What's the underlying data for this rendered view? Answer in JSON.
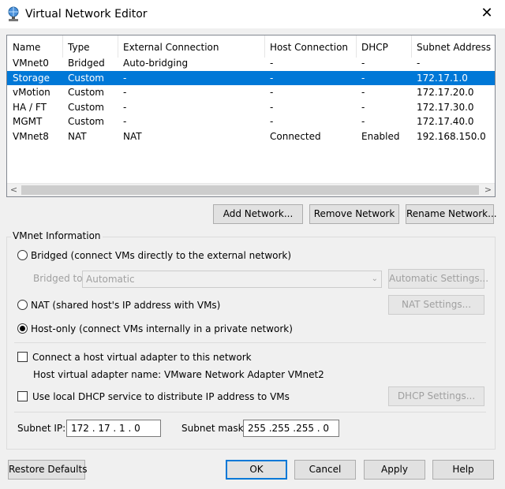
{
  "window": {
    "title": "Virtual Network Editor",
    "close_glyph": "✕",
    "icon": "network-globe-icon"
  },
  "table": {
    "columns": [
      "Name",
      "Type",
      "External Connection",
      "Host Connection",
      "DHCP",
      "Subnet Address"
    ],
    "rows": [
      {
        "name": "VMnet0",
        "type": "Bridged",
        "external": "Auto-bridging",
        "host": "-",
        "dhcp": "-",
        "subnet": "-"
      },
      {
        "name": "Storage",
        "type": "Custom",
        "external": "-",
        "host": "-",
        "dhcp": "-",
        "subnet": "172.17.1.0",
        "selected": true
      },
      {
        "name": "vMotion",
        "type": "Custom",
        "external": "-",
        "host": "-",
        "dhcp": "-",
        "subnet": "172.17.20.0"
      },
      {
        "name": "HA / FT",
        "type": "Custom",
        "external": "-",
        "host": "-",
        "dhcp": "-",
        "subnet": "172.17.30.0"
      },
      {
        "name": "MGMT",
        "type": "Custom",
        "external": "-",
        "host": "-",
        "dhcp": "-",
        "subnet": "172.17.40.0"
      },
      {
        "name": "VMnet8",
        "type": "NAT",
        "external": "NAT",
        "host": "Connected",
        "dhcp": "Enabled",
        "subnet": "192.168.150.0"
      }
    ],
    "scroll_left": "<",
    "scroll_right": ">"
  },
  "actions": {
    "add": "Add Network...",
    "remove": "Remove Network",
    "rename": "Rename Network..."
  },
  "vmnet_info": {
    "legend": "VMnet Information",
    "bridged_label": "Bridged (connect VMs directly to the external network)",
    "bridged_to_label": "Bridged to:",
    "bridged_to_value": "Automatic",
    "automatic_settings": "Automatic Settings...",
    "nat_label": "NAT (shared host's IP address with VMs)",
    "nat_settings": "NAT Settings...",
    "hostonly_label": "Host-only (connect VMs internally in a private network)",
    "selected_mode": "host-only",
    "connect_adapter_label": "Connect a host virtual adapter to this network",
    "adapter_name_text": "Host virtual adapter name: VMware Network Adapter VMnet2",
    "dhcp_label": "Use local DHCP service to distribute IP address to VMs",
    "dhcp_settings": "DHCP Settings...",
    "subnet_ip_label": "Subnet IP:",
    "subnet_ip_value": "172 . 17 . 1 . 0",
    "subnet_mask_label": "Subnet mask:",
    "subnet_mask_value": "255 .255 .255 . 0"
  },
  "footer": {
    "restore": "Restore Defaults",
    "ok": "OK",
    "cancel": "Cancel",
    "apply": "Apply",
    "help": "Help"
  },
  "colors": {
    "selection": "#0078d7",
    "dialog_bg": "#f0f0f0"
  }
}
